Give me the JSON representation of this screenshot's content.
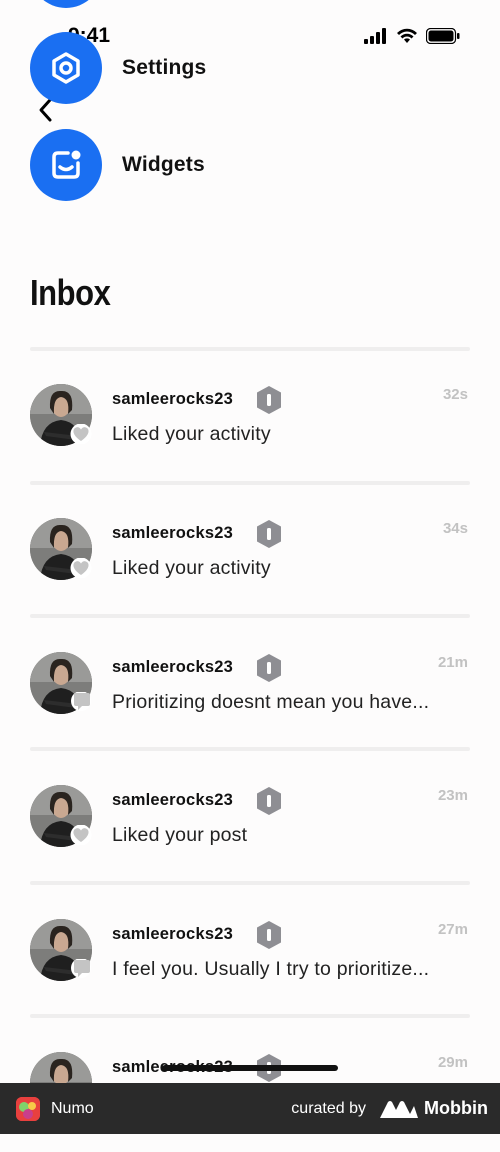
{
  "status_bar": {
    "time": "9:41"
  },
  "menu": [
    {
      "label": "Settings",
      "icon": "settings-icon"
    },
    {
      "label": "Widgets",
      "icon": "widgets-icon"
    }
  ],
  "inbox": {
    "title": "Inbox",
    "items": [
      {
        "username": "samleerocks23",
        "message": "Liked your activity",
        "time": "32s",
        "type": "like"
      },
      {
        "username": "samleerocks23",
        "message": "Liked your activity",
        "time": "34s",
        "type": "like"
      },
      {
        "username": "samleerocks23",
        "message": "Prioritizing doesnt mean you have...",
        "time": "21m",
        "type": "comment"
      },
      {
        "username": "samleerocks23",
        "message": "Liked your post",
        "time": "23m",
        "type": "like"
      },
      {
        "username": "samleerocks23",
        "message": "I feel you. Usually I try to prioritize...",
        "time": "27m",
        "type": "comment"
      },
      {
        "username": "samleerocks23",
        "message": "",
        "time": "29m",
        "type": "like"
      }
    ]
  },
  "footer": {
    "app_name": "Numo",
    "curated_by": "curated by",
    "brand": "Mobbin"
  },
  "colors": {
    "accent": "#1a6ff2",
    "muted": "#c2c2c2",
    "footer_bg": "#2a2a2a"
  }
}
